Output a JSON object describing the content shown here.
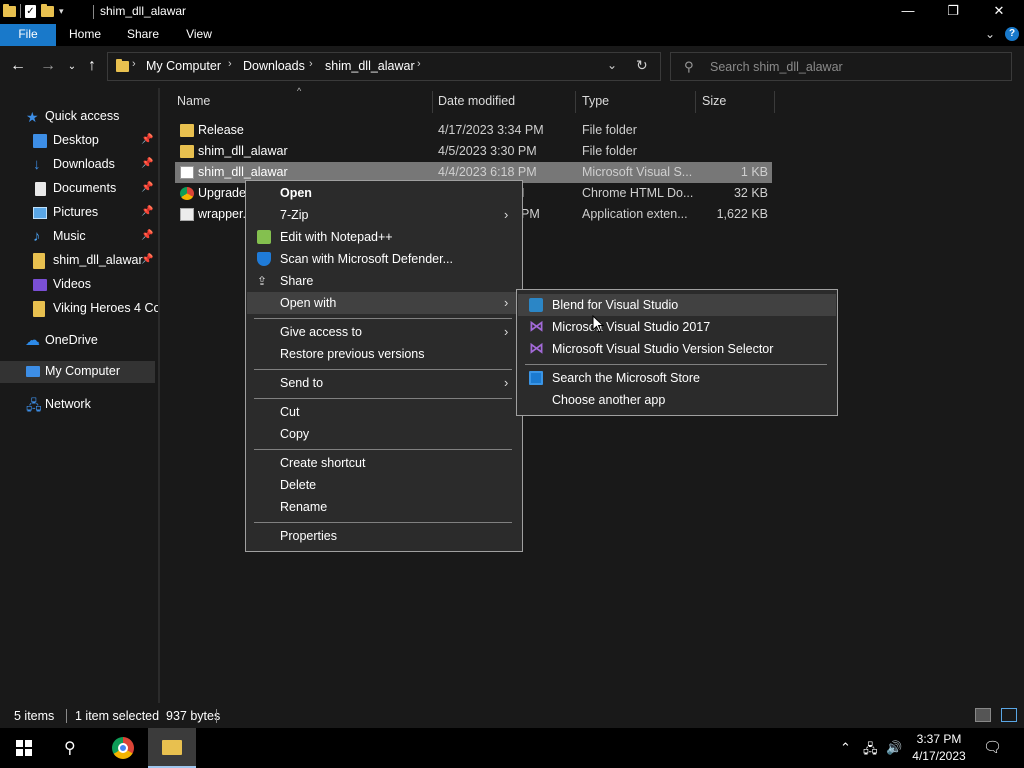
{
  "window": {
    "title": "shim_dll_alawar",
    "minimize": "—",
    "maximize": "❐",
    "close": "✕"
  },
  "ribbon": {
    "tabs": [
      "File",
      "Home",
      "Share",
      "View"
    ],
    "help": "?"
  },
  "address": {
    "crumbs": [
      "My Computer",
      "Downloads",
      "shim_dll_alawar"
    ],
    "search_placeholder": "Search shim_dll_alawar"
  },
  "nav": {
    "items": [
      {
        "label": "Quick access",
        "icon": "star-icon",
        "pinned": false
      },
      {
        "label": "Desktop",
        "icon": "desktop-icon",
        "pinned": true
      },
      {
        "label": "Downloads",
        "icon": "download-icon",
        "pinned": true
      },
      {
        "label": "Documents",
        "icon": "documents-icon",
        "pinned": true
      },
      {
        "label": "Pictures",
        "icon": "pictures-icon",
        "pinned": true
      },
      {
        "label": "Music",
        "icon": "music-icon",
        "pinned": true
      },
      {
        "label": "shim_dll_alawar",
        "icon": "folder-icon",
        "pinned": true
      },
      {
        "label": "Videos",
        "icon": "videos-icon",
        "pinned": false
      },
      {
        "label": "Viking Heroes 4 Col",
        "icon": "folder-icon",
        "pinned": false
      },
      {
        "label": "OneDrive",
        "icon": "cloud-icon",
        "pinned": false
      },
      {
        "label": "My Computer",
        "icon": "computer-icon",
        "pinned": false
      },
      {
        "label": "Network",
        "icon": "network-icon",
        "pinned": false
      }
    ]
  },
  "columns": {
    "name": "Name",
    "date": "Date modified",
    "type": "Type",
    "size": "Size"
  },
  "files": [
    {
      "name": "Release",
      "date": "4/17/2023 3:34 PM",
      "type": "File folder",
      "size": "",
      "icon": "folder-icon"
    },
    {
      "name": "shim_dll_alawar",
      "date": "4/5/2023 3:30 PM",
      "type": "File folder",
      "size": "",
      "icon": "folder-icon"
    },
    {
      "name": "shim_dll_alawar",
      "date": "4/4/2023 6:18 PM",
      "type": "Microsoft Visual S...",
      "size": "1 KB",
      "icon": "vs-solution-icon"
    },
    {
      "name": "Upgrade",
      "date": "M",
      "type": "Chrome HTML Do...",
      "size": "32 KB",
      "icon": "chrome-icon"
    },
    {
      "name": "wrapper.",
      "date": "PM",
      "type": "Application exten...",
      "size": "1,622 KB",
      "icon": "dll-icon"
    }
  ],
  "context_menu": {
    "items": [
      {
        "label": "Open",
        "bold": true
      },
      {
        "label": "7-Zip",
        "submenu": true
      },
      {
        "label": "Edit with Notepad++",
        "icon": "notepadpp-icon"
      },
      {
        "label": "Scan with Microsoft Defender...",
        "icon": "defender-icon"
      },
      {
        "label": "Share",
        "icon": "share-icon"
      },
      {
        "label": "Open with",
        "submenu": true
      },
      {
        "label": "Give access to",
        "submenu": true
      },
      {
        "label": "Restore previous versions"
      },
      {
        "label": "Send to",
        "submenu": true
      },
      {
        "label": "Cut"
      },
      {
        "label": "Copy"
      },
      {
        "label": "Create shortcut"
      },
      {
        "label": "Delete"
      },
      {
        "label": "Rename"
      },
      {
        "label": "Properties"
      }
    ]
  },
  "open_with_menu": {
    "items": [
      {
        "label": "Blend for Visual Studio",
        "icon": "blend-icon"
      },
      {
        "label": "Microsoft Visual Studio 2017",
        "icon": "visual-studio-icon"
      },
      {
        "label": "Microsoft Visual Studio Version Selector",
        "icon": "visual-studio-icon"
      },
      {
        "label": "Search the Microsoft Store",
        "icon": "store-icon"
      },
      {
        "label": "Choose another app"
      }
    ]
  },
  "status": {
    "items": "5 items",
    "selected": "1 item selected  937 bytes"
  },
  "taskbar": {
    "time": "3:37 PM",
    "date": "4/17/2023"
  },
  "colors": {
    "accent": "#1979ca",
    "background": "#191919",
    "menu": "#2b2b2b",
    "selection": "#777777"
  }
}
